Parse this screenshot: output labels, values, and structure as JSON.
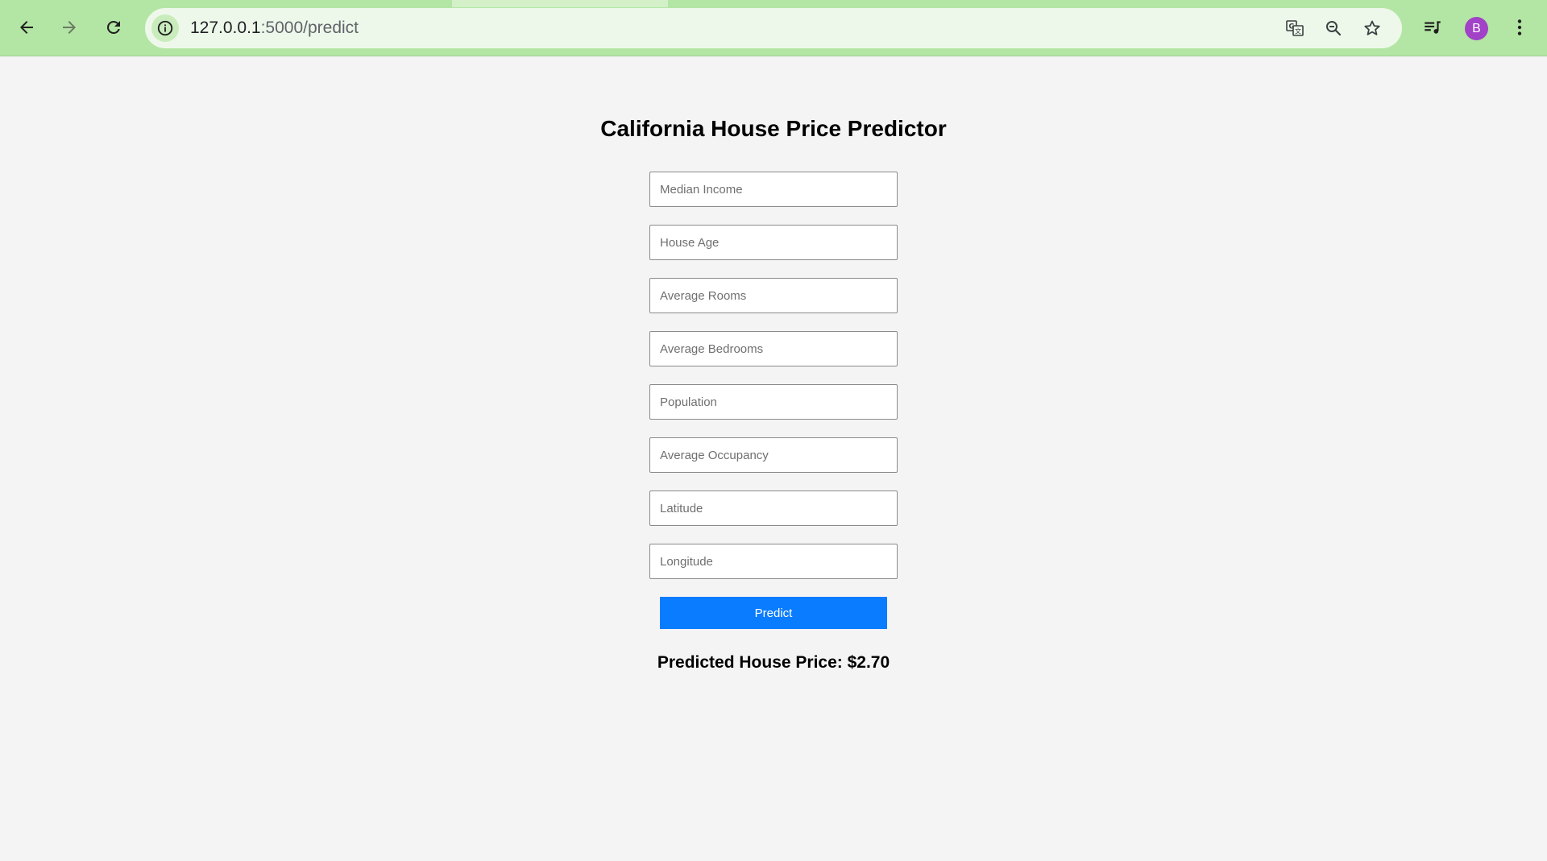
{
  "browser": {
    "url_host": "127.0.0.1",
    "url_rest": ":5000/predict",
    "profile_initial": "B",
    "accent_color": "#b3e6a4"
  },
  "page": {
    "title": "California House Price Predictor",
    "fields": [
      {
        "placeholder": "Median Income",
        "value": ""
      },
      {
        "placeholder": "House Age",
        "value": ""
      },
      {
        "placeholder": "Average Rooms",
        "value": ""
      },
      {
        "placeholder": "Average Bedrooms",
        "value": ""
      },
      {
        "placeholder": "Population",
        "value": ""
      },
      {
        "placeholder": "Average Occupancy",
        "value": ""
      },
      {
        "placeholder": "Latitude",
        "value": ""
      },
      {
        "placeholder": "Longitude",
        "value": ""
      }
    ],
    "predict_label": "Predict",
    "predict_color": "#0a7cff",
    "result_text": "Predicted House Price: $2.70"
  },
  "icons": {
    "back": "back-arrow-icon",
    "forward": "forward-arrow-icon",
    "reload": "reload-icon",
    "site_info": "info-icon",
    "translate": "translate-icon",
    "zoom": "zoom-icon",
    "bookmark": "star-icon",
    "media": "media-playlist-icon",
    "menu": "kebab-menu-icon"
  }
}
